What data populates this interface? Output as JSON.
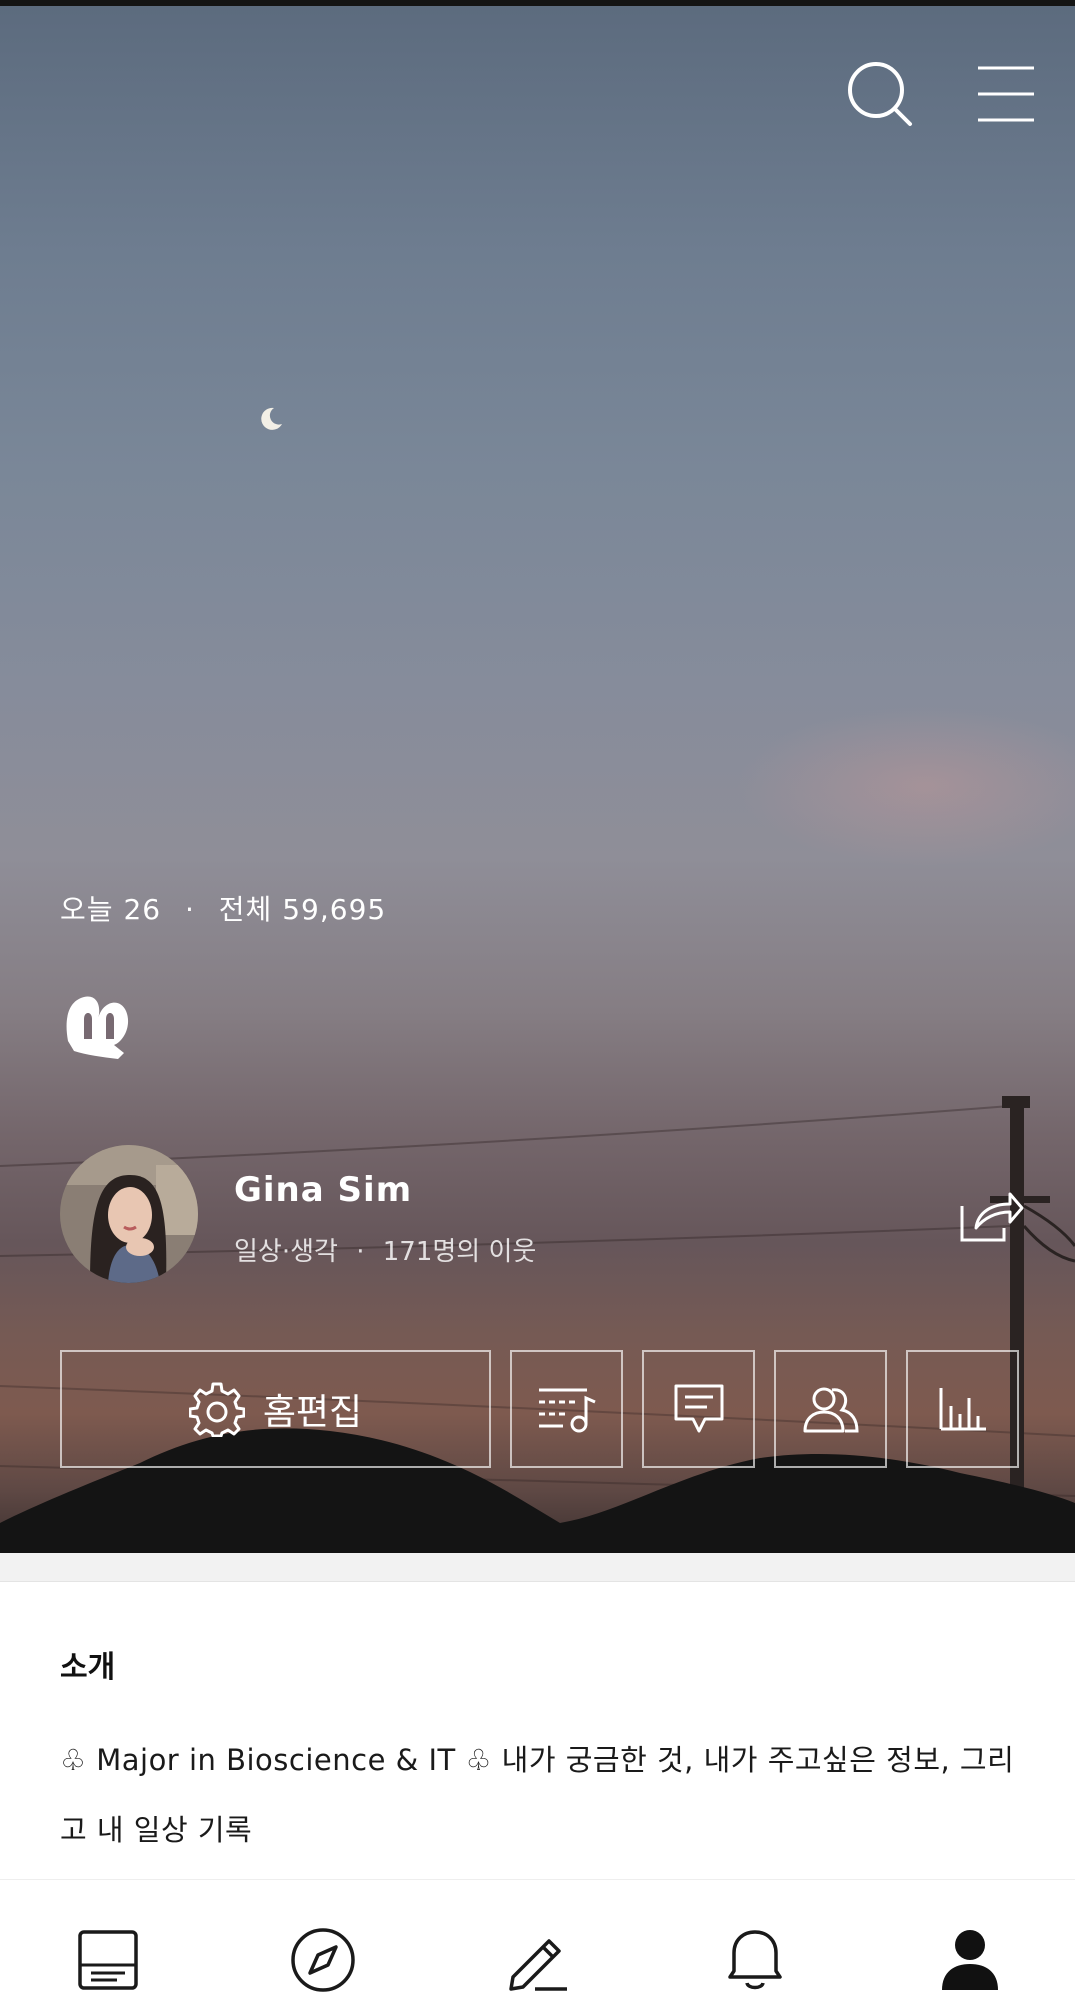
{
  "header": {
    "search_icon": "search-icon",
    "menu_icon": "hamburger-menu-icon"
  },
  "blog": {
    "today_label": "오늘",
    "today_count": "26",
    "total_label": "전체",
    "total_count": "59,695",
    "separator": "·",
    "logo_icon": "blog-logo-icon"
  },
  "profile": {
    "name": "Gina Sim",
    "category": "일상·생각",
    "dot": "·",
    "neighbors": "171명의 이웃",
    "share_icon": "share-icon"
  },
  "actions": {
    "edit_home_label": "홈편집",
    "edit_home_icon": "gear-icon",
    "buttons": [
      {
        "icon": "playlist-icon"
      },
      {
        "icon": "comment-icon"
      },
      {
        "icon": "neighbors-icon"
      },
      {
        "icon": "stats-icon"
      }
    ]
  },
  "intro": {
    "title": "소개",
    "text": "♧ Major in Bioscience & IT ♧ 내가 궁금한 것, 내가 주고싶은 정보, 그리고 내 일상 기록"
  },
  "tabbar": {
    "items": [
      {
        "icon": "feed-icon"
      },
      {
        "icon": "compass-icon"
      },
      {
        "icon": "pencil-icon"
      },
      {
        "icon": "bell-icon"
      },
      {
        "icon": "profile-icon",
        "active": true
      }
    ]
  },
  "colors": {
    "sky_top": "#5c6b7e",
    "sky_bottom": "#7e5a4f",
    "text_dark": "#111111",
    "white": "#ffffff"
  }
}
